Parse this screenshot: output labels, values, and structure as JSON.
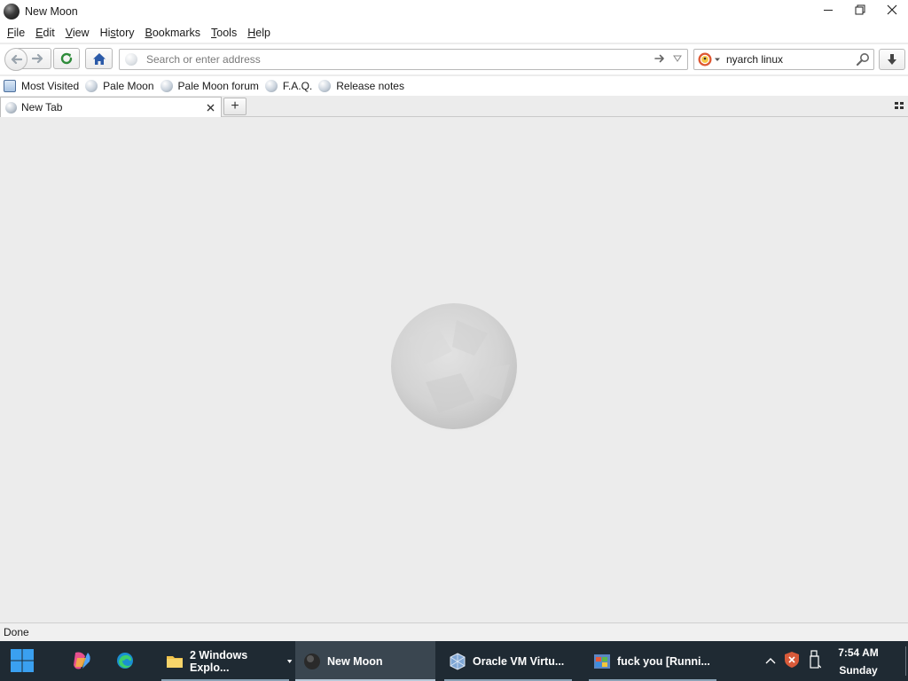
{
  "window": {
    "title": "New Moon",
    "controls": {
      "minimize": "minimize",
      "maximize": "restore",
      "close": "close"
    }
  },
  "menu": {
    "items": [
      {
        "label": "File",
        "accel": "F",
        "rest": "ile"
      },
      {
        "label": "Edit",
        "accel": "E",
        "rest": "dit"
      },
      {
        "label": "View",
        "accel": "V",
        "rest": "iew"
      },
      {
        "label": "History",
        "accel": "",
        "pre": "Hi",
        "accel_mid": "s",
        "rest": "tory"
      },
      {
        "label": "Bookmarks",
        "accel": "B",
        "rest": "ookmarks"
      },
      {
        "label": "Tools",
        "accel": "T",
        "rest": "ools"
      },
      {
        "label": "Help",
        "accel": "H",
        "rest": "elp"
      }
    ]
  },
  "navbar": {
    "url_placeholder": "Search or enter address",
    "url_value": "",
    "search_value": "nyarch linux",
    "search_engine": "duckduckgo-icon"
  },
  "bookmarks": {
    "items": [
      "Most Visited",
      "Pale Moon",
      "Pale Moon forum",
      "F.A.Q.",
      "Release notes"
    ]
  },
  "tabs": {
    "items": [
      {
        "label": "New Tab",
        "active": true
      }
    ],
    "new_tab_label": "+"
  },
  "status": {
    "text": "Done"
  },
  "taskbar": {
    "tasks": [
      {
        "label": "2 Windows Explo...",
        "icon": "folder-icon"
      },
      {
        "label": "New Moon",
        "icon": "new-moon-icon",
        "active": true
      },
      {
        "label": "Oracle VM Virtu...",
        "icon": "virtualbox-icon"
      },
      {
        "label": "fuck you [Runni...",
        "icon": "vm-window-icon"
      }
    ],
    "clock": {
      "time": "7:54 AM",
      "day": "Sunday"
    }
  },
  "colors": {
    "taskbar_bg": "#1f2a33",
    "content_bg": "#ececec",
    "home_icon": "#2b5aa8",
    "reload_icon": "#2e8b3a"
  }
}
